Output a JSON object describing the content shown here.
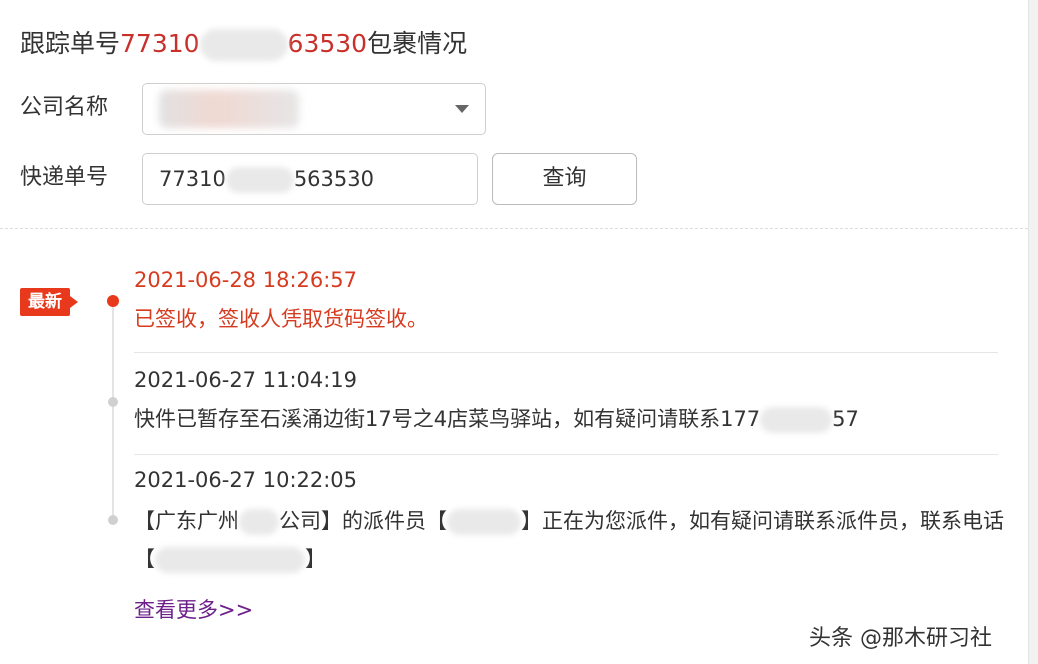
{
  "title": {
    "prefix": "跟踪单号",
    "number_start": "77310",
    "number_end": "63530",
    "suffix": "包裹情况"
  },
  "form": {
    "company_label": "公司名称",
    "tracking_label": "快递单号",
    "tracking_value_start": "77310",
    "tracking_value_end": "563530",
    "query_button": "查询"
  },
  "timeline": {
    "latest_badge": "最新",
    "events": [
      {
        "time": "2021-06-28 18:26:57",
        "desc": "已签收，签收人凭取货码签收。"
      },
      {
        "time": "2021-06-27 11:04:19",
        "desc_start": "快件已暂存至石溪涌边街17号之4店菜鸟驿站，如有疑问请联系177",
        "desc_end": "57"
      },
      {
        "time": "2021-06-27 10:22:05",
        "desc_part1": "【广东广州",
        "desc_part2": "公司】的派件员【",
        "desc_part3": "】正在为您派件，如有疑问请联系派件员，联系电话【",
        "desc_part4": "】"
      }
    ]
  },
  "more_link": "查看更多>>",
  "watermark": "头条 @那木研习社",
  "colors": {
    "accent_red": "#d73b1f",
    "badge_red": "#e8391d",
    "link_purple": "#6d1f8a"
  }
}
